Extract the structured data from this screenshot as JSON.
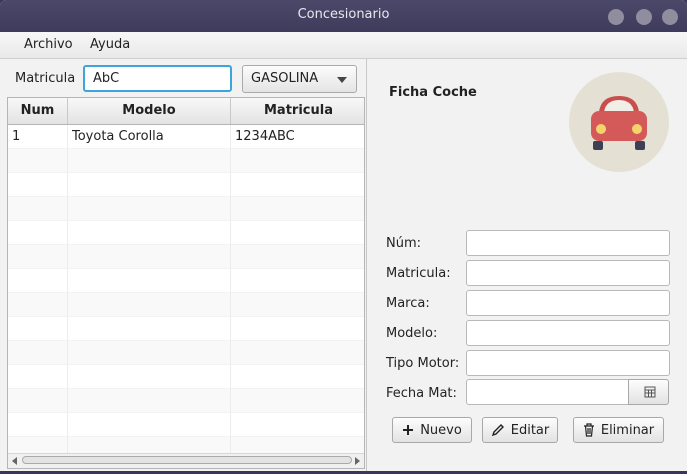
{
  "window": {
    "title": "Concesionario"
  },
  "menu": {
    "items": [
      "Archivo",
      "Ayuda"
    ]
  },
  "filter": {
    "label": "Matricula",
    "value": "AbC",
    "fuel_selected": "GASOLINA"
  },
  "table": {
    "columns": [
      "Num",
      "Modelo",
      "Matricula"
    ],
    "rows": [
      [
        "1",
        "Toyota Corolla",
        "1234ABC"
      ]
    ]
  },
  "detail": {
    "heading": "Ficha Coche",
    "fields": {
      "num": {
        "label": "Núm:",
        "value": ""
      },
      "matricula": {
        "label": "Matricula:",
        "value": ""
      },
      "marca": {
        "label": "Marca:",
        "value": ""
      },
      "modelo": {
        "label": "Modelo:",
        "value": ""
      },
      "tipo_motor": {
        "label": "Tipo Motor:",
        "value": ""
      },
      "fecha_mat": {
        "label": "Fecha Mat:",
        "value": ""
      }
    },
    "buttons": {
      "nuevo": "Nuevo",
      "editar": "Editar",
      "eliminar": "Eliminar"
    }
  },
  "icons": {
    "car": "car-icon",
    "plus": "plus-icon",
    "pencil": "pencil-icon",
    "trash": "trash-icon",
    "calendar": "calendar-icon"
  },
  "colors": {
    "accent": "#3ea5dc",
    "car_body": "#d45a5a",
    "car_circle": "#e4e1d4",
    "titlebar": "#44415f"
  }
}
